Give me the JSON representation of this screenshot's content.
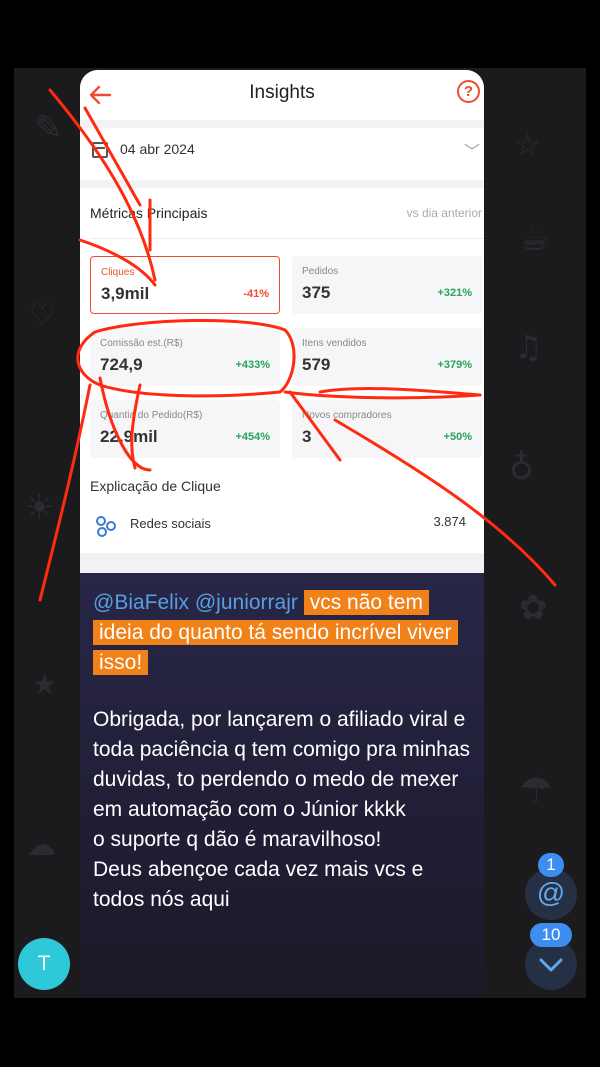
{
  "insights": {
    "title": "Insights",
    "date": "04 abr 2024",
    "metrics_title": "Métricas Principais",
    "compare_label": "vs dia anterior",
    "tiles": [
      {
        "label": "Cliques",
        "value": "3,9mil",
        "change": "-41%"
      },
      {
        "label": "Pedidos",
        "value": "375",
        "change": "+321%"
      },
      {
        "label": "Comissão est.(R$)",
        "value": "724,9",
        "change": "+433%"
      },
      {
        "label": "Itens vendidos",
        "value": "579",
        "change": "+379%"
      },
      {
        "label": "Quantia do Pedido(R$)",
        "value": "22,9mil",
        "change": "+454%"
      },
      {
        "label": "Novos compradores",
        "value": "3",
        "change": "+50%"
      }
    ],
    "click_explanation_title": "Explicação de Clique",
    "social_label": "Redes sociais",
    "social_value": "3.874"
  },
  "message": {
    "mention1": "@BiaFelix",
    "mention2": "@juniorrajr",
    "highlight": "vcs não tem ideia do quanto tá sendo incrível viver isso!",
    "body": "Obrigada, por lançarem o afiliado viral e toda paciência q tem comigo pra minhas duvidas, to perdendo o medo de mexer em automação com o Júnior kkkk\no suporte q dão é maravilhoso!\nDeus abençoe cada vez mais vcs e todos nós aqui"
  },
  "avatar_letter": "T",
  "fab": {
    "mention_badge": "1",
    "mention_symbol": "@",
    "unread_badge": "10"
  },
  "colors": {
    "accent_orange": "#ee4d2d",
    "highlight": "#f18219",
    "mention_blue": "#5a9ee0",
    "positive_green": "#27a35b",
    "avatar": "#2ec8d8"
  }
}
